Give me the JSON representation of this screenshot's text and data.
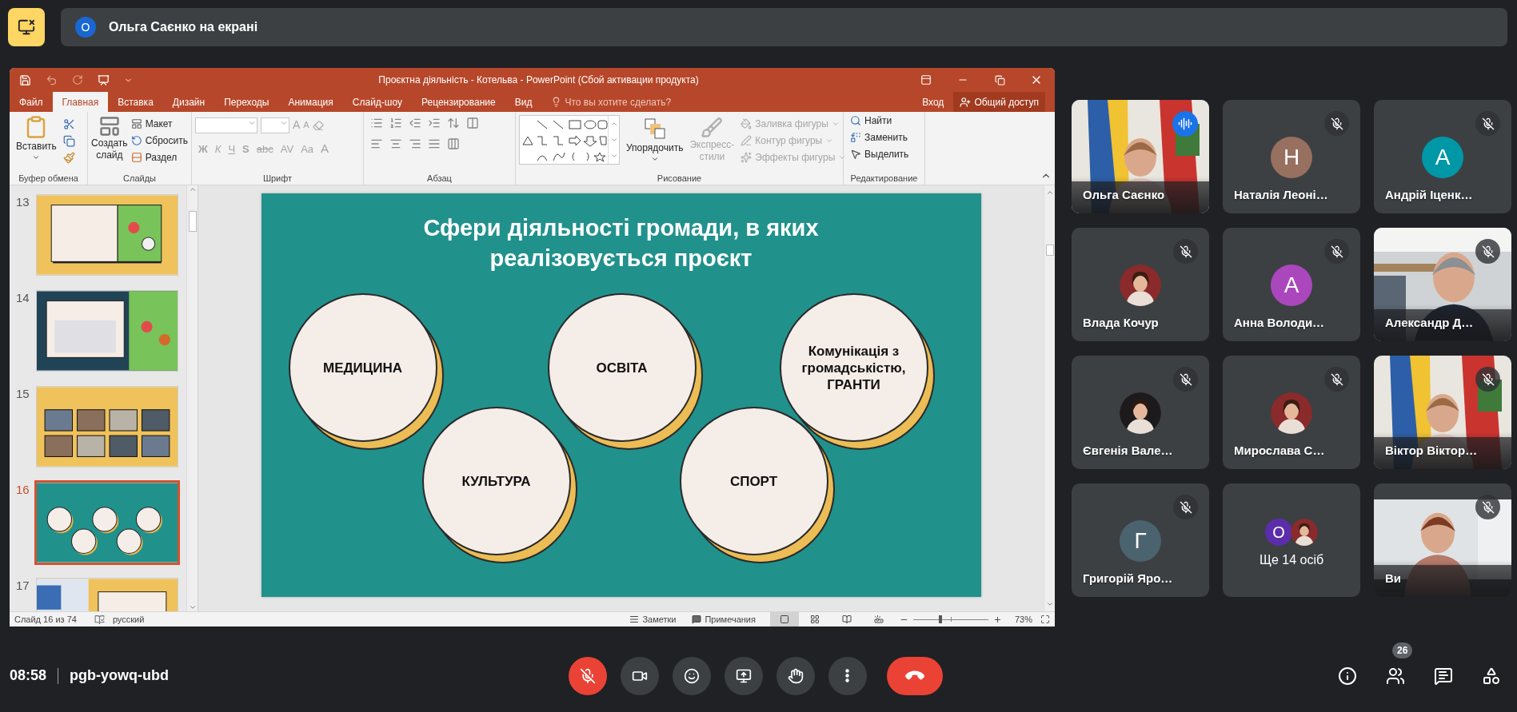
{
  "top_bar": {
    "presenter_initial": "О",
    "banner": "Ольга Саєнко на екрані"
  },
  "powerpoint": {
    "title": "Проєктна діяльність - Котельва - PowerPoint (Сбой активации продукта)",
    "tabs": [
      {
        "label": "Файл",
        "selected": false
      },
      {
        "label": "Главная",
        "selected": true
      },
      {
        "label": "Вставка",
        "selected": false
      },
      {
        "label": "Дизайн",
        "selected": false
      },
      {
        "label": "Переходы",
        "selected": false
      },
      {
        "label": "Анимация",
        "selected": false
      },
      {
        "label": "Слайд-шоу",
        "selected": false
      },
      {
        "label": "Рецензирование",
        "selected": false
      },
      {
        "label": "Вид",
        "selected": false
      }
    ],
    "tell_me": "Что вы хотите сделать?",
    "sign_in": "Вход",
    "share": "Общий доступ",
    "ribbon": {
      "clipboard": {
        "paste": "Вставить",
        "group": "Буфер обмена"
      },
      "slides": {
        "new_slide": "Создать слайд",
        "layout": "Макет",
        "reset": "Сбросить",
        "section": "Раздел",
        "group": "Слайды"
      },
      "font": {
        "disabled": true,
        "grow": "A",
        "shrink": "A",
        "buttons": [
          "Ж",
          "К",
          "Ч",
          "S",
          "abc",
          "AV",
          "Aa",
          "A"
        ],
        "group": "Шрифт"
      },
      "paragraph": {
        "group": "Абзац"
      },
      "drawing": {
        "arrange": "Упорядочить",
        "quick_styles": {
          "label": "Экспресс-стили",
          "disabled": true
        },
        "shape_options": [
          {
            "label": "Заливка фигуры",
            "disabled": true
          },
          {
            "label": "Контур фигуры",
            "disabled": true
          },
          {
            "label": "Эффекты фигуры",
            "disabled": true
          }
        ],
        "group": "Рисование"
      },
      "editing": {
        "items": [
          {
            "label": "Найти",
            "kind": "find"
          },
          {
            "label": "Заменить",
            "kind": "replace"
          },
          {
            "label": "Выделить",
            "kind": "select"
          }
        ],
        "group": "Редактирование"
      }
    },
    "thumbnails": [
      {
        "number": "13",
        "selected": false
      },
      {
        "number": "14",
        "selected": false
      },
      {
        "number": "15",
        "selected": false
      },
      {
        "number": "16",
        "selected": true
      },
      {
        "number": "17",
        "selected": false
      }
    ],
    "slide": {
      "title": "Сфери діяльності громади, в яких реалізовується проєкт",
      "topics": [
        {
          "label": "МЕДИЦИНА"
        },
        {
          "label": "ОСВІТА"
        },
        {
          "label": "Комунікація з громадськістю, ГРАНТИ"
        },
        {
          "label": "КУЛЬТУРА"
        },
        {
          "label": "СПОРТ"
        }
      ]
    },
    "status_bar": {
      "slide_count": "Слайд 16 из 74",
      "language": "русский",
      "notes": "Заметки",
      "comments": "Примечания",
      "zoom": {
        "level": 0.36
      },
      "zoom_reading": "73%"
    }
  },
  "participants": [
    {
      "name": "Ольга Саєнко",
      "kind": "video",
      "muted": false,
      "speaking": true
    },
    {
      "name": "Наталія Леоні…",
      "kind": "letter",
      "initial": "Н",
      "color": "#98705f",
      "muted": true,
      "speaking": false
    },
    {
      "name": "Андрій Іценк…",
      "kind": "letter",
      "initial": "А",
      "color": "#0097a7",
      "muted": true,
      "speaking": false
    },
    {
      "name": "Влада Кочур",
      "muted": true,
      "speaking": false
    },
    {
      "name": "Анна Володи…",
      "kind": "letter",
      "initial": "А",
      "color": "#ab47bc",
      "muted": true,
      "speaking": false
    },
    {
      "name": "Александр Д…",
      "kind": "video",
      "muted": true,
      "speaking": false
    },
    {
      "name": "Євгенія Вале…",
      "muted": true,
      "speaking": false
    },
    {
      "name": "Мирослава С…",
      "muted": true,
      "speaking": false
    },
    {
      "name": "Віктор Віктор…",
      "kind": "video",
      "muted": true,
      "speaking": false
    },
    {
      "name": "Григорій Яро…",
      "kind": "letter",
      "initial": "Г",
      "color": "#4b636e",
      "muted": true,
      "speaking": false
    },
    {
      "name": "Ще 14 осіб",
      "kind": "more",
      "initial": "О",
      "color": "#5b2dab",
      "muted": false,
      "speaking": false
    },
    {
      "name": "Ви",
      "kind": "video",
      "muted": true,
      "speaking": false
    }
  ],
  "meeting": {
    "time": "08:58",
    "code": "pgb-yowq-ubd",
    "people_count": "26",
    "controls": [
      {
        "kind": "mic",
        "on": false
      },
      {
        "kind": "camera",
        "on": true
      },
      {
        "kind": "emoji"
      },
      {
        "kind": "present"
      },
      {
        "kind": "hand"
      },
      {
        "kind": "more"
      },
      {
        "kind": "leave"
      }
    ]
  }
}
